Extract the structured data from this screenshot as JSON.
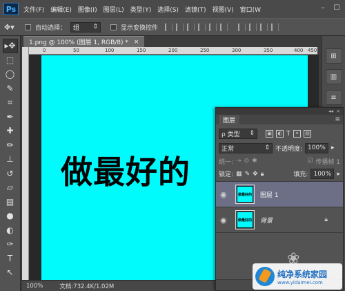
{
  "menubar": {
    "logo": "Ps",
    "items": [
      "文件(F)",
      "编辑(E)",
      "图像(I)",
      "图层(L)",
      "类型(Y)",
      "选择(S)",
      "滤镜(T)",
      "视图(V)",
      "窗口(W"
    ]
  },
  "options": {
    "auto_select_label": "自动选择：",
    "auto_select_value": "组",
    "show_transform_label": "显示变换控件"
  },
  "document": {
    "tab_title": "1.png @ 100% (图层 1, RGB/8) *",
    "close": "×",
    "ruler_ticks": [
      "0",
      "50",
      "100",
      "150",
      "200",
      "250",
      "300",
      "350",
      "400",
      "450"
    ],
    "canvas_text": "做最好的",
    "zoom": "100%",
    "doc_info": "文档:732.4K/1.02M"
  },
  "layers_panel": {
    "tab": "图层",
    "filter_label": "ρ 类型",
    "blend_mode": "正常",
    "opacity_label": "不透明度:",
    "opacity_value": "100%",
    "unify_label": "统一:",
    "propagate_label": "传播帧 1",
    "lock_label": "锁定:",
    "fill_label": "填充:",
    "fill_value": "100%",
    "layers": [
      {
        "name": "图层 1",
        "thumb_text": "做最好的"
      },
      {
        "name": "背景",
        "thumb_text": "做最好的"
      }
    ]
  },
  "watermark": {
    "title": "纯净系统家园",
    "url": "www.yidaimei.com"
  },
  "colors": {
    "canvas": "#00fbfd",
    "selected_layer": "#6c6f86"
  }
}
